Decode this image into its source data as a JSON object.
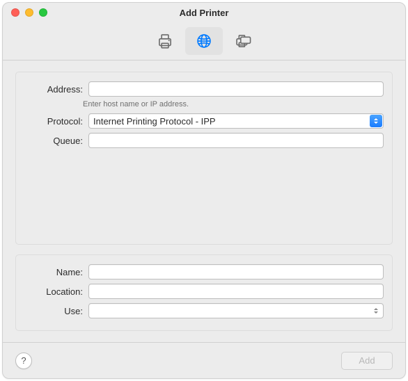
{
  "window": {
    "title": "Add Printer"
  },
  "toolbar": {
    "tabs": [
      {
        "id": "default-printer",
        "selected": false
      },
      {
        "id": "ip-printer",
        "selected": true
      },
      {
        "id": "windows-printer",
        "selected": false
      }
    ]
  },
  "form_top": {
    "address": {
      "label": "Address:",
      "value": "",
      "hint": "Enter host name or IP address."
    },
    "protocol": {
      "label": "Protocol:",
      "value": "Internet Printing Protocol - IPP"
    },
    "queue": {
      "label": "Queue:",
      "value": ""
    }
  },
  "form_bottom": {
    "name": {
      "label": "Name:",
      "value": ""
    },
    "location": {
      "label": "Location:",
      "value": ""
    },
    "use": {
      "label": "Use:",
      "value": ""
    }
  },
  "footer": {
    "help_symbol": "?",
    "add_label": "Add",
    "add_enabled": false
  }
}
